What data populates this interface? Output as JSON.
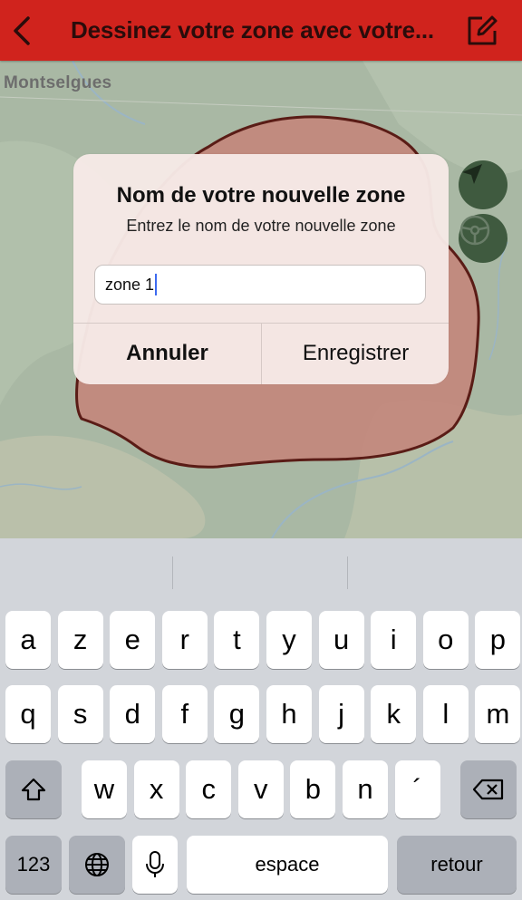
{
  "header": {
    "title": "Dessinez votre zone avec votre...",
    "bg_color": "#d0231d"
  },
  "map": {
    "place_label": "Montselgues",
    "zone_fill": "#c4847a",
    "zone_stroke": "#5a1c16",
    "buttons": [
      "navigation-arrow-icon",
      "steering-wheel-icon"
    ]
  },
  "dialog": {
    "title": "Nom de votre nouvelle zone",
    "message": "Entrez le nom de votre nouvelle zone",
    "input_value": "zone 1",
    "cancel_label": "Annuler",
    "save_label": "Enregistrer"
  },
  "keyboard": {
    "row1": [
      "a",
      "z",
      "e",
      "r",
      "t",
      "y",
      "u",
      "i",
      "o",
      "p"
    ],
    "row2": [
      "q",
      "s",
      "d",
      "f",
      "g",
      "h",
      "j",
      "k",
      "l",
      "m"
    ],
    "row3": [
      "w",
      "x",
      "c",
      "v",
      "b",
      "n",
      "´"
    ],
    "numbers_label": "123",
    "space_label": "espace",
    "return_label": "retour"
  }
}
